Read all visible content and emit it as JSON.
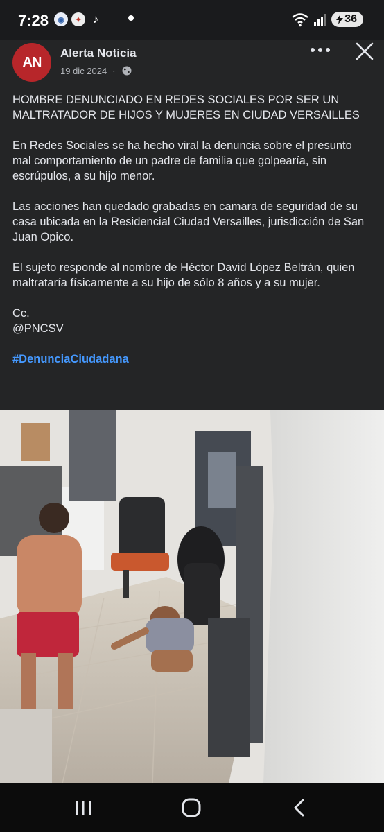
{
  "status_bar": {
    "time": "7:28",
    "battery": "36",
    "app_icons": [
      "messenger-icon",
      "news-app-icon",
      "tiktok-icon"
    ]
  },
  "post": {
    "avatar_initials": "AN",
    "author": "Alerta Noticia",
    "date": "19 dic 2024",
    "paragraphs": [
      "HOMBRE DENUNCIADO EN REDES SOCIALES POR SER UN MALTRATADOR DE HIJOS Y MUJERES EN CIUDAD VERSAILLES",
      "En Redes Sociales se ha hecho viral la denuncia sobre el presunto mal comportamiento de un padre de familia que golpearía, sin escrúpulos, a su hijo menor.",
      "Las acciones han quedado grabadas en camara de seguridad de su casa ubicada en la Residencial Ciudad Versailles, jurisdicción de San Juan Opico.",
      "El sujeto responde al nombre de  Héctor David López Beltrán, quien maltrataría físicamente a su hijo de sólo 8 años y a su mujer.",
      "Cc.\n@PNCSV"
    ],
    "hashtag": "#DenunciaCiudadana"
  },
  "colors": {
    "panel_bg": "#242526",
    "text": "#e4e6eb",
    "secondary_text": "#b0b3b8",
    "hashtag": "#4599ff",
    "avatar_bg": "#b7262a"
  }
}
